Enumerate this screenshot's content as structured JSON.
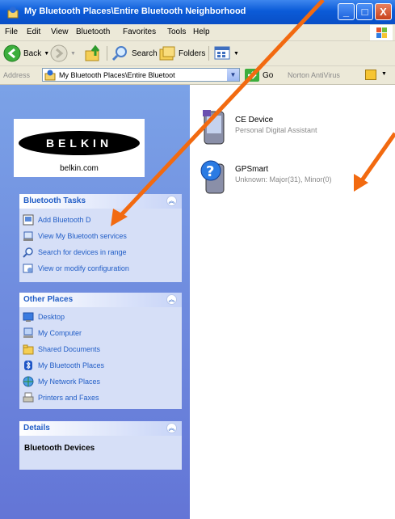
{
  "window": {
    "title": "My Bluetooth Places\\Entire Bluetooth Neighborhood",
    "controls": {
      "minimize": "_",
      "maximize": "□",
      "close": "X"
    }
  },
  "menu": [
    "File",
    "Edit",
    "View",
    "Bluetooth",
    "Favorites",
    "Tools",
    "Help"
  ],
  "toolbar": {
    "back_label": "Back",
    "search_label": "Search",
    "folders_label": "Folders"
  },
  "address": {
    "label": "Address",
    "value": "My Bluetooth Places\\Entire Bluetoot",
    "go_label": "Go",
    "norton_label": "Norton AntiVirus"
  },
  "logo": {
    "text": "BELKIN",
    "url": "belkin.com"
  },
  "task_groups": {
    "bluetooth_tasks": {
      "title": "Bluetooth Tasks",
      "items": [
        {
          "label": "Add Bluetooth D",
          "icon": "add-device-icon"
        },
        {
          "label": "View My Bluetooth services",
          "icon": "view-services-icon"
        },
        {
          "label": "Search for devices in range",
          "icon": "search-icon"
        },
        {
          "label": "View or modify configuration",
          "icon": "configuration-icon"
        }
      ]
    },
    "other_places": {
      "title": "Other Places",
      "items": [
        {
          "label": "Desktop",
          "icon": "desktop-icon"
        },
        {
          "label": "My Computer",
          "icon": "my-computer-icon"
        },
        {
          "label": "Shared Documents",
          "icon": "shared-documents-icon"
        },
        {
          "label": "My Bluetooth Places",
          "icon": "bluetooth-places-icon"
        },
        {
          "label": "My Network Places",
          "icon": "network-places-icon"
        },
        {
          "label": "Printers and Faxes",
          "icon": "printers-faxes-icon"
        }
      ]
    },
    "details": {
      "title": "Details",
      "text": "Bluetooth Devices"
    }
  },
  "devices": [
    {
      "name": "CE Device",
      "description": "Personal Digital Assistant",
      "icon": "pda-icon"
    },
    {
      "name": "GPSmart",
      "description": "Unknown: Major(31), Minor(0)",
      "icon": "unknown-device-icon"
    }
  ],
  "colors": {
    "accent_arrow": "#f26a10",
    "link_blue": "#215dc6",
    "titlebar_blue": "#0b5bd8"
  }
}
